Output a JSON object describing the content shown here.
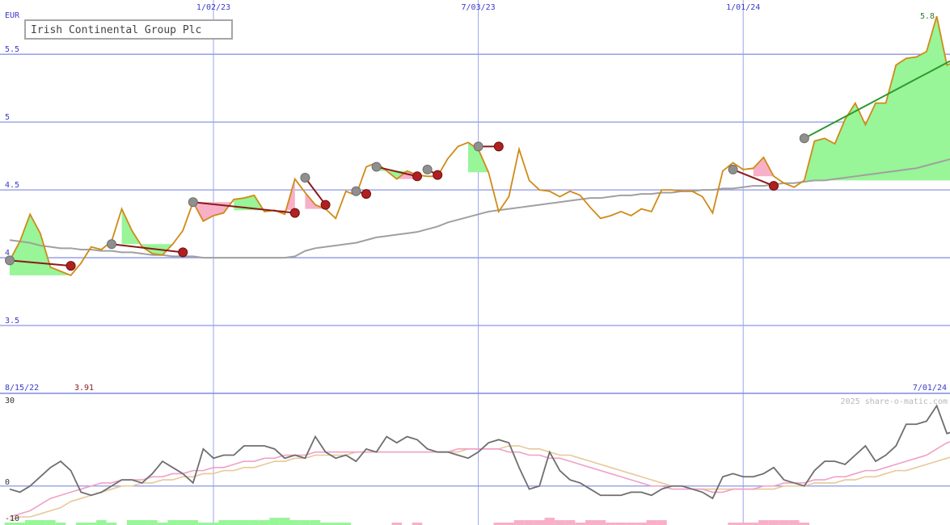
{
  "chart_data": [
    {
      "type": "line",
      "title": "Irish Continental Group Plc",
      "currency": "EUR",
      "ylim": [
        3.0,
        5.9
      ],
      "y_ticks": [
        "5.5",
        "5",
        "4.5",
        "4",
        "3.5"
      ],
      "y_tick_values": [
        5.5,
        5.0,
        4.5,
        4.0,
        3.5
      ],
      "x_ticks": [
        "1/02/23",
        "7/03/23",
        "1/01/24"
      ],
      "x_tick_weeks": [
        20,
        46,
        72
      ],
      "start_date": "8/15/22",
      "end_date": "7/01/24",
      "start_value": "3.91",
      "end_value": "5.8",
      "colors": {
        "price": "#d08a16",
        "ma": "#a0a0a0",
        "up_fill": "#98f598",
        "down_fill": "#f7b0c8",
        "down_trend": "#8b1a1a",
        "up_trend": "#2e9a2e",
        "grid": "#8c96e6"
      },
      "series": [
        {
          "values": [
            3.98,
            4.12,
            4.32,
            4.18,
            3.93,
            3.9,
            3.87,
            3.96,
            4.08,
            4.06,
            4.12,
            4.36,
            4.2,
            4.08,
            4.03,
            4.02,
            4.1,
            4.2,
            4.41,
            4.27,
            4.31,
            4.33,
            4.43,
            4.44,
            4.46,
            4.34,
            4.35,
            4.32,
            4.58,
            4.48,
            4.39,
            4.36,
            4.29,
            4.49,
            4.46,
            4.67,
            4.7,
            4.64,
            4.58,
            4.64,
            4.61,
            4.6,
            4.6,
            4.73,
            4.82,
            4.85,
            4.8,
            4.63,
            4.34,
            4.45,
            4.8,
            4.57,
            4.5,
            4.49,
            4.45,
            4.49,
            4.46,
            4.37,
            4.29,
            4.31,
            4.34,
            4.31,
            4.36,
            4.34,
            4.5,
            4.5,
            4.49,
            4.49,
            4.45,
            4.33,
            4.64,
            4.7,
            4.65,
            4.66,
            4.74,
            4.6,
            4.55,
            4.52,
            4.57,
            4.86,
            4.88,
            4.84,
            5.02,
            5.14,
            4.98,
            5.14,
            5.14,
            5.42,
            5.47,
            5.48,
            5.52,
            5.78,
            5.42,
            5.45
          ]
        },
        {
          "values": [
            4.13,
            4.12,
            4.11,
            4.09,
            4.08,
            4.07,
            4.07,
            4.06,
            4.06,
            4.05,
            4.05,
            4.04,
            4.04,
            4.03,
            4.02,
            4.02,
            4.01,
            4.01,
            4.01,
            4.0,
            4.0,
            4.0,
            4.0,
            4.0,
            4.0,
            4.0,
            4.0,
            4.0,
            4.01,
            4.05,
            4.07,
            4.08,
            4.09,
            4.1,
            4.11,
            4.13,
            4.15,
            4.16,
            4.17,
            4.18,
            4.19,
            4.21,
            4.23,
            4.26,
            4.28,
            4.3,
            4.32,
            4.34,
            4.35,
            4.36,
            4.37,
            4.38,
            4.39,
            4.4,
            4.41,
            4.42,
            4.43,
            4.44,
            4.44,
            4.45,
            4.46,
            4.46,
            4.47,
            4.47,
            4.48,
            4.48,
            4.49,
            4.49,
            4.5,
            4.5,
            4.51,
            4.51,
            4.52,
            4.53,
            4.53,
            4.54,
            4.55,
            4.55,
            4.56,
            4.57,
            4.57,
            4.58,
            4.59,
            4.6,
            4.61,
            4.62,
            4.63,
            4.64,
            4.65,
            4.66,
            4.68,
            4.7,
            4.72,
            4.74
          ]
        }
      ],
      "annotations": {
        "down_trends": [
          [
            0,
            3.98,
            6,
            3.94
          ],
          [
            10,
            4.1,
            17,
            4.04
          ],
          [
            18,
            4.41,
            28,
            4.33
          ],
          [
            29,
            4.59,
            31,
            4.39
          ],
          [
            34,
            4.49,
            35,
            4.47
          ],
          [
            36,
            4.67,
            40,
            4.6
          ],
          [
            41,
            4.65,
            42,
            4.61
          ],
          [
            46,
            4.82,
            48,
            4.82
          ],
          [
            71,
            4.65,
            75,
            4.53
          ]
        ],
        "up_trends": [
          [
            78,
            4.88,
            93,
            5.45
          ]
        ],
        "up_fills": [
          [
            0,
            6
          ],
          [
            11,
            16
          ],
          [
            22,
            26
          ],
          [
            36,
            39
          ],
          [
            45,
            47
          ],
          [
            72,
            74
          ],
          [
            78,
            93
          ]
        ],
        "down_fills": [
          [
            18,
            22
          ],
          [
            26,
            28
          ],
          [
            29,
            31
          ],
          [
            38,
            40
          ],
          [
            73,
            75
          ]
        ]
      }
    },
    {
      "type": "line",
      "watermark": "2025 share-o-matic.com",
      "ylim": [
        -10,
        30
      ],
      "y_ticks": [
        "30",
        "0",
        "-10"
      ],
      "y_tick_values": [
        30,
        0,
        -10
      ],
      "series": [
        {
          "values": [
            -1,
            -2,
            0,
            3,
            6,
            8,
            5,
            -2,
            -3,
            -2,
            0,
            2,
            2,
            1,
            4,
            8,
            6,
            4,
            1,
            12,
            9,
            10,
            10,
            13,
            13,
            13,
            12,
            9,
            10,
            9,
            16,
            11,
            9,
            10,
            8,
            12,
            11,
            16,
            14,
            16,
            15,
            12,
            11,
            11,
            10,
            9,
            11,
            14,
            15,
            14,
            6,
            -1,
            0,
            11,
            5,
            2,
            1,
            -1,
            -3,
            -3,
            -3,
            -2,
            -2,
            -3,
            -1,
            0,
            0,
            -1,
            -2,
            -4,
            3,
            4,
            3,
            3,
            4,
            6,
            2,
            1,
            0,
            5,
            8,
            8,
            7,
            10,
            13,
            8,
            10,
            13,
            20,
            20,
            21,
            26,
            17,
            18
          ]
        },
        {
          "values": [
            -10,
            -9,
            -8,
            -6,
            -4,
            -3,
            -2,
            -1,
            0,
            1,
            1,
            2,
            2,
            2,
            3,
            3,
            4,
            4,
            5,
            5,
            6,
            6,
            7,
            8,
            8,
            9,
            9,
            10,
            10,
            10,
            11,
            11,
            11,
            11,
            11,
            11,
            11,
            11,
            11,
            11,
            11,
            11,
            11,
            11,
            12,
            12,
            12,
            12,
            12,
            11,
            11,
            10,
            10,
            9,
            9,
            8,
            7,
            6,
            5,
            4,
            3,
            2,
            1,
            0,
            0,
            -1,
            -1,
            -1,
            -1,
            -2,
            -2,
            -1,
            -1,
            -1,
            0,
            0,
            1,
            1,
            1,
            2,
            2,
            3,
            3,
            4,
            5,
            5,
            6,
            7,
            8,
            9,
            10,
            12,
            14,
            15
          ]
        },
        {
          "values": [
            -11,
            -10,
            -10,
            -9,
            -8,
            -7,
            -5,
            -4,
            -3,
            -2,
            -1,
            0,
            0,
            1,
            1,
            2,
            2,
            3,
            3,
            4,
            4,
            5,
            5,
            6,
            6,
            7,
            8,
            8,
            9,
            9,
            10,
            10,
            10,
            10,
            11,
            11,
            11,
            11,
            11,
            11,
            11,
            11,
            11,
            11,
            11,
            12,
            12,
            12,
            12,
            13,
            13,
            12,
            12,
            11,
            10,
            10,
            9,
            8,
            7,
            6,
            5,
            4,
            3,
            2,
            1,
            0,
            0,
            -1,
            -1,
            -1,
            -1,
            -1,
            -1,
            -1,
            -1,
            -1,
            0,
            0,
            0,
            1,
            1,
            1,
            2,
            2,
            3,
            3,
            4,
            5,
            5,
            6,
            7,
            8,
            9,
            10
          ]
        }
      ],
      "bars": {
        "positive_color": "#98f598",
        "negative_color": "#f7b0c8",
        "values": [
          1,
          1,
          2,
          2,
          2,
          1,
          0,
          1,
          1,
          2,
          1,
          0,
          2,
          2,
          2,
          1,
          2,
          2,
          2,
          1,
          1,
          2,
          2,
          2,
          2,
          2,
          3,
          3,
          2,
          2,
          2,
          1,
          1,
          1,
          0,
          0,
          0,
          0,
          -1,
          0,
          -1,
          0,
          0,
          0,
          0,
          0,
          0,
          0,
          -1,
          -1,
          -2,
          -2,
          -2,
          -3,
          -2,
          -2,
          -1,
          -2,
          -2,
          -1,
          -1,
          -1,
          -1,
          -2,
          -2,
          0,
          0,
          0,
          0,
          0,
          0,
          -1,
          -1,
          -1,
          -2,
          -2,
          -2,
          -2,
          -1,
          0,
          0,
          0,
          0,
          0,
          0,
          0,
          0,
          0,
          0,
          0,
          0,
          0,
          0,
          0
        ]
      }
    }
  ]
}
